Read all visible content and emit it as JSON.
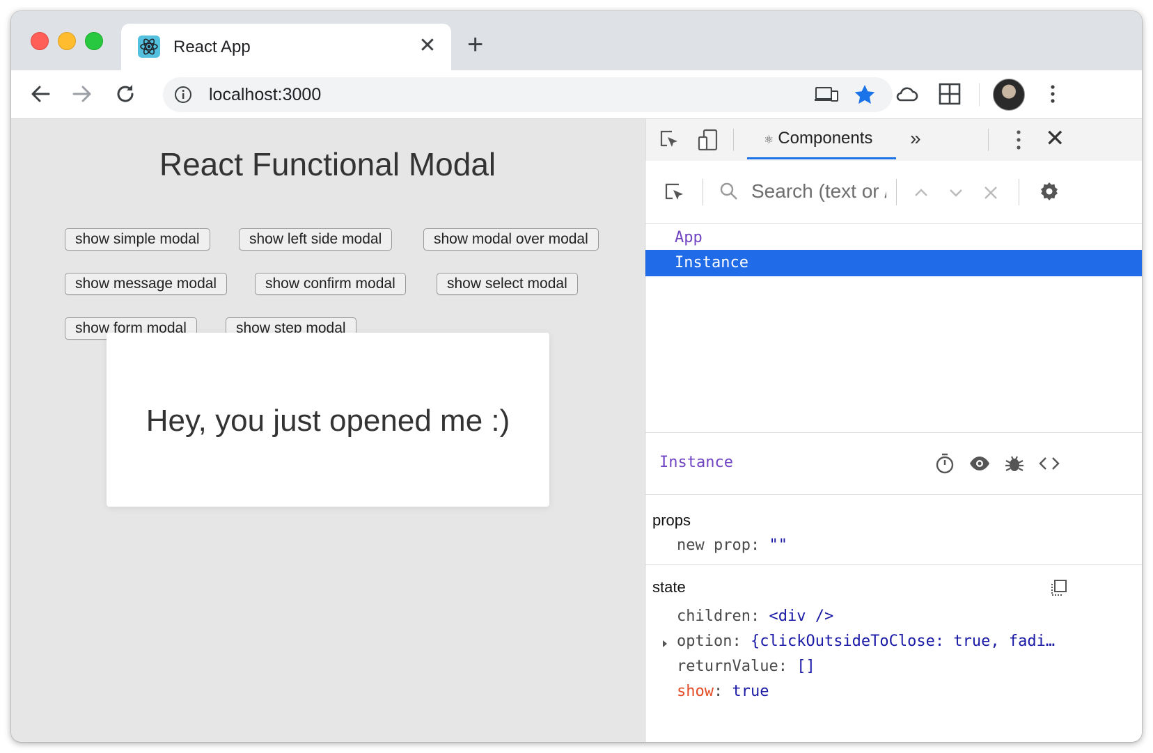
{
  "browser": {
    "tab_title": "React App",
    "tab_close": "✕",
    "new_tab": "+",
    "url": "localhost:3000"
  },
  "page": {
    "title": "React Functional Modal",
    "buttons": [
      "show simple modal",
      "show left side modal",
      "show modal over modal",
      "show message modal",
      "show confirm modal",
      "show select modal",
      "show form modal",
      "show step modal"
    ],
    "modal_text": "Hey, you just opened me :)"
  },
  "devtools": {
    "active_tab": "Components",
    "more_tabs": "»",
    "close": "✕",
    "search_placeholder": "Search (text or /regex/)",
    "tree": [
      "App",
      "Instance"
    ],
    "selected_component": "Instance",
    "props_title": "props",
    "props": [
      {
        "key": "new prop",
        "value": "\"\""
      }
    ],
    "state_title": "state",
    "state": [
      {
        "key": "children",
        "value": "<div />"
      },
      {
        "key": "option",
        "value": "{clickOutsideToClose: true, fadi…"
      },
      {
        "key": "returnValue",
        "value": "[]"
      },
      {
        "key": "show",
        "value": "true"
      }
    ]
  },
  "colors": {
    "selection": "#1f6be8",
    "component_name": "#7044c2",
    "value": "#1a1aa6",
    "changed_key": "#e34c26"
  }
}
